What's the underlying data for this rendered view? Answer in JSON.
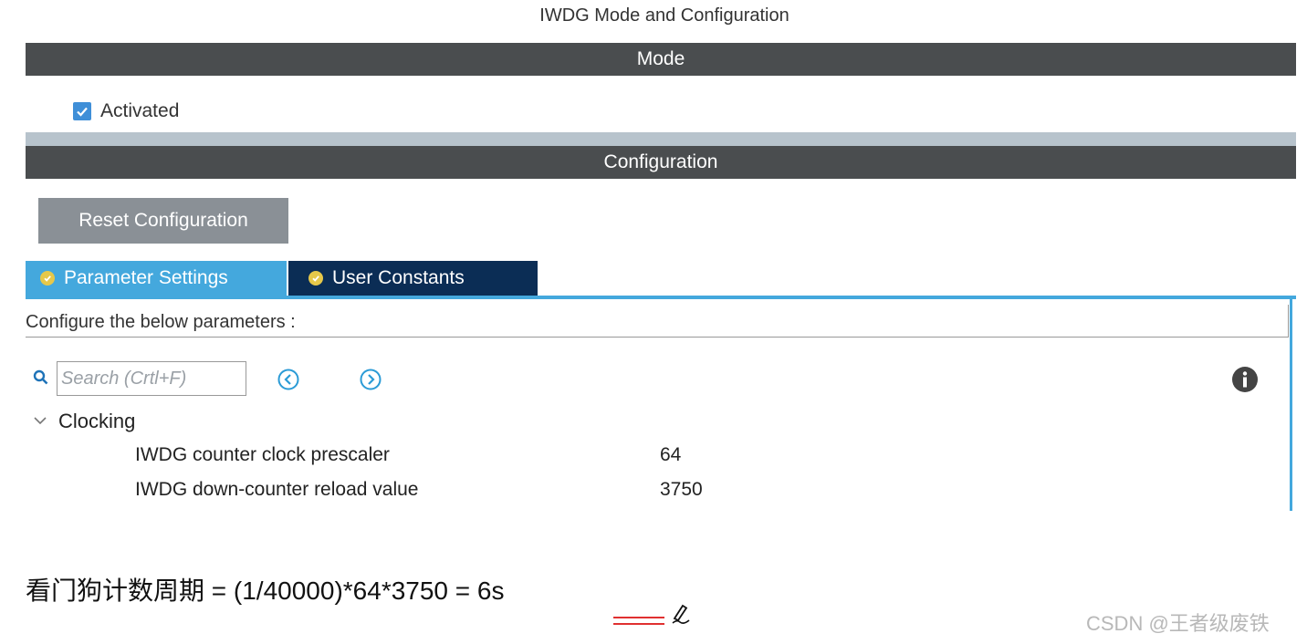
{
  "title": "IWDG Mode and Configuration",
  "mode": {
    "header": "Mode",
    "activated": {
      "label": "Activated",
      "checked": true
    }
  },
  "configuration": {
    "header": "Configuration",
    "reset_button": "Reset Configuration",
    "tabs": [
      {
        "label": "Parameter Settings",
        "active": true
      },
      {
        "label": "User Constants",
        "active": false
      }
    ],
    "instructions": "Configure the below parameters :",
    "search": {
      "placeholder": "Search (Crtl+F)"
    },
    "group": {
      "label": "Clocking",
      "params": [
        {
          "name": "IWDG counter clock prescaler",
          "value": "64"
        },
        {
          "name": "IWDG down-counter reload value",
          "value": "3750"
        }
      ]
    }
  },
  "annotation": {
    "formula": "看门狗计数周期 = (1/40000)*64*3750 = 6s"
  },
  "watermark": "CSDN @王者级废铁",
  "icons": {
    "search": "search-icon",
    "prev": "circle-chevron-left-icon",
    "next": "circle-chevron-right-icon",
    "info": "info-icon",
    "collapse": "chevron-down-icon",
    "check": "checkmark-icon",
    "pen": "pen-icon"
  },
  "colors": {
    "band": "#4a4d4f",
    "tab_active": "#44a8dd",
    "tab_inactive": "#0b2d55",
    "checkbox": "#3f8fd8",
    "reset_button": "#8a9096",
    "tab_check": "#e6c84a",
    "underline": "#e03030"
  }
}
